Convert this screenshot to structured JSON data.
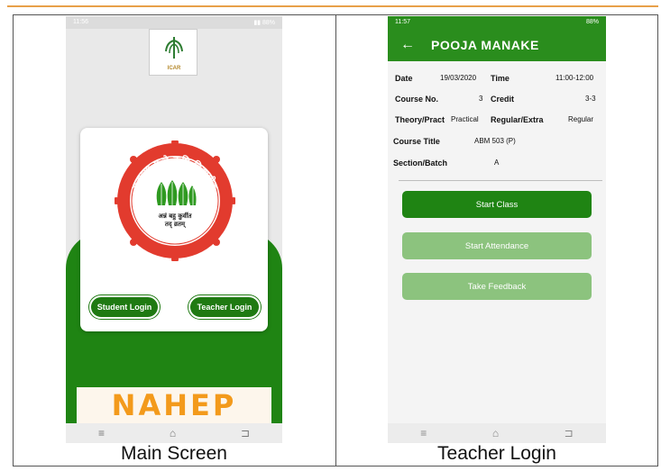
{
  "captions": {
    "left": "Main Screen",
    "right": "Teacher Login"
  },
  "main_screen": {
    "icar_label": "ICAR",
    "seal_text_top": "महात्मा फुले कृषि विद्यापीठ",
    "seal_text_center_1": "अन्नं बहु कुर्वीत",
    "seal_text_center_2": "तद् व्रतम्",
    "student_login": "Student Login",
    "teacher_login": "Teacher Login",
    "nahep_logo": "NAHEP"
  },
  "teacher_screen": {
    "status_time": "11:57",
    "status_right": "88%",
    "title": "POOJA MANAKE",
    "fields": {
      "date_label": "Date",
      "date_value": "19/03/2020",
      "time_label": "Time",
      "time_value": "11:00-12:00",
      "course_no_label": "Course No.",
      "course_no_value": "3",
      "credit_label": "Credit",
      "credit_value": "3-3",
      "theory_label": "Theory/Pract",
      "theory_value": "Practical",
      "regular_label": "Regular/Extra",
      "regular_value": "Regular",
      "course_title_label": "Course Title",
      "course_title_value": "ABM 503 (P)",
      "section_label": "Section/Batch",
      "section_value": "A"
    },
    "buttons": {
      "start_class": "Start Class",
      "start_attendance": "Start Attendance",
      "take_feedback": "Take Feedback"
    }
  },
  "colors": {
    "primary_green": "#1f8413",
    "light_green": "#8cc37e",
    "accent_orange": "#f39a1b"
  }
}
